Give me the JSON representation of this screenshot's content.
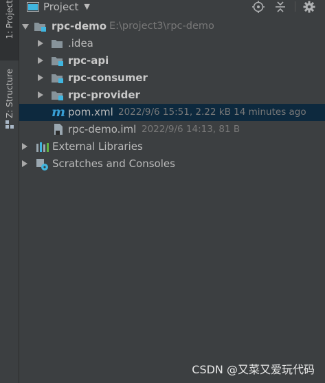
{
  "side_tabs": {
    "project": "1: Project",
    "structure": "Z: Structure"
  },
  "header": {
    "title": "Project"
  },
  "tree": {
    "root": {
      "name": "rpc-demo",
      "path": "E:\\project3\\rpc-demo"
    },
    "children": [
      {
        "name": ".idea"
      },
      {
        "name": "rpc-api"
      },
      {
        "name": "rpc-consumer"
      },
      {
        "name": "rpc-provider"
      }
    ],
    "files": [
      {
        "name": "pom.xml",
        "meta": "2022/9/6 15:51, 2.22 kB 14 minutes ago",
        "icon_letter": "m"
      },
      {
        "name": "rpc-demo.iml",
        "meta": "2022/9/6 14:13, 81 B"
      }
    ],
    "external_libraries": "External Libraries",
    "scratches": "Scratches and Consoles"
  },
  "watermark": "CSDN @又菜又爱玩代码",
  "colors": {
    "background": "#3c3f41",
    "selection": "#0d293e",
    "text": "#bbbbbb",
    "meta_text": "#787878",
    "folder": "#87939a",
    "module_badge": "#40b6e0",
    "maven_m": "#389fd6"
  }
}
